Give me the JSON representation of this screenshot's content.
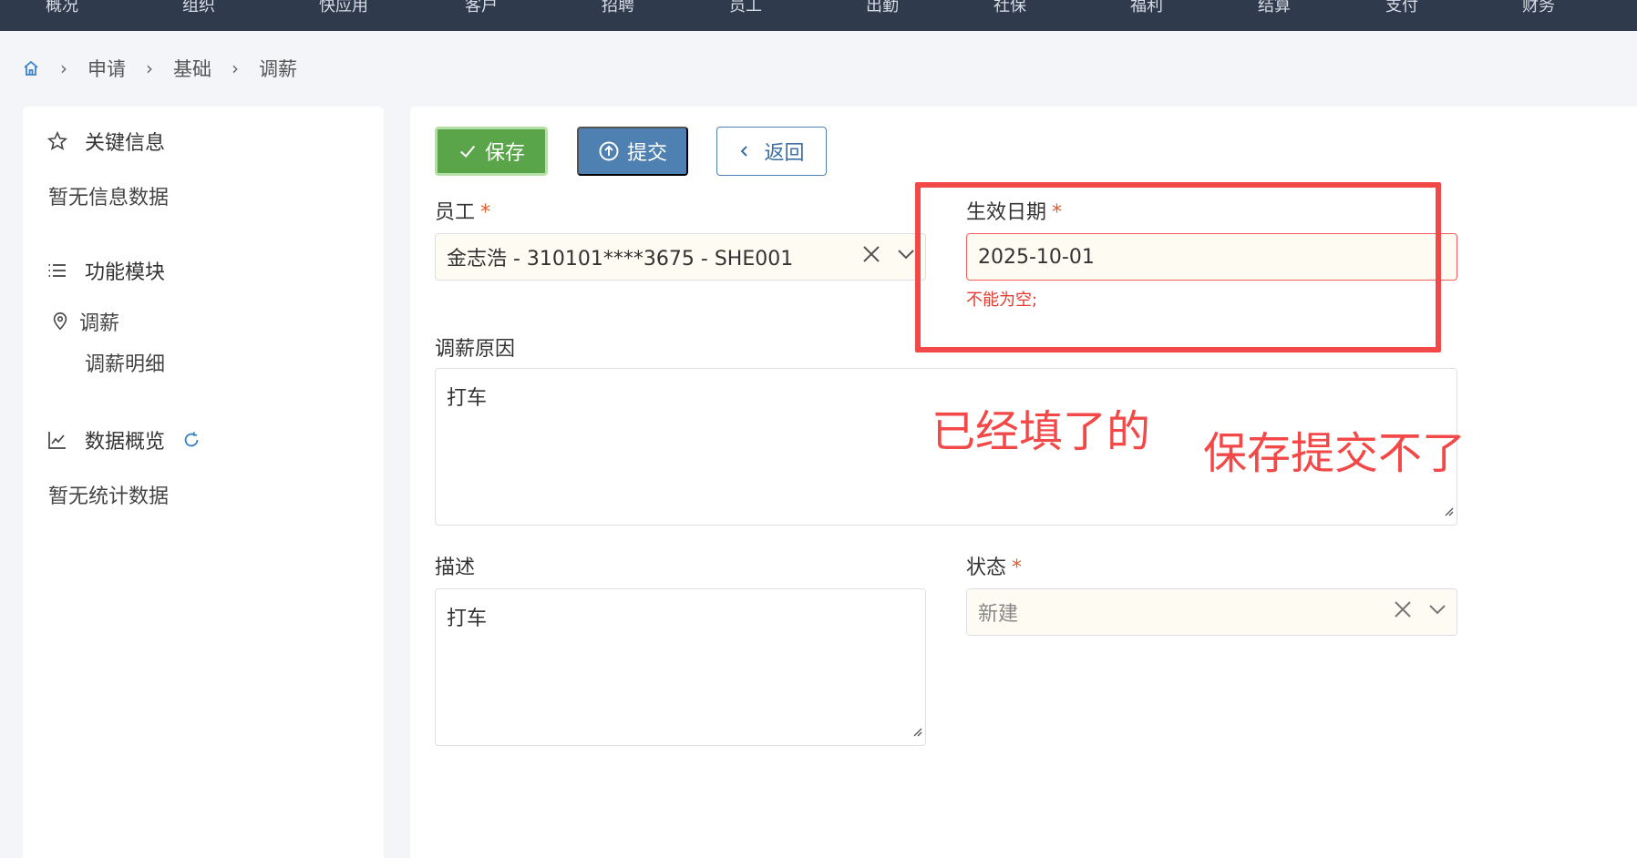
{
  "topnav": {
    "items": [
      "概况",
      "组织",
      "快应用",
      "客户",
      "招聘",
      "员工",
      "出勤",
      "社保",
      "福利",
      "结算",
      "支付",
      "财务"
    ]
  },
  "breadcrumb": {
    "home_icon": "home-icon",
    "items": [
      "申请",
      "基础",
      "调薪"
    ]
  },
  "sidebar": {
    "key_info": {
      "title": "关键信息",
      "icon": "star-icon",
      "empty": "暂无信息数据"
    },
    "modules": {
      "title": "功能模块",
      "icon": "list-icon",
      "item": {
        "label": "调薪",
        "icon": "location-pin-icon"
      },
      "sub_item": "调薪明细"
    },
    "overview": {
      "title": "数据概览",
      "icon": "trend-chart-icon",
      "refresh_icon": "refresh-icon",
      "empty": "暂无统计数据"
    }
  },
  "toolbar": {
    "save_label": "保存",
    "submit_label": "提交",
    "back_label": "返回"
  },
  "form": {
    "employee": {
      "label": "员工",
      "required": "*",
      "value": "金志浩 - 310101****3675 - SHE001"
    },
    "effective_date": {
      "label": "生效日期",
      "required": "*",
      "value": "2025-10-01",
      "error": "不能为空;"
    },
    "reason": {
      "label": "调薪原因",
      "value": "打车"
    },
    "description": {
      "label": "描述",
      "value": "打车"
    },
    "status": {
      "label": "状态",
      "required": "*",
      "value": "新建"
    }
  },
  "annotations": {
    "note1": "已经填了的",
    "note2": "保存提交不了"
  },
  "colors": {
    "accent_green": "#5aa54a",
    "accent_blue": "#4f80b2",
    "error_red": "#e8392f",
    "annotation_red": "#f24848"
  }
}
